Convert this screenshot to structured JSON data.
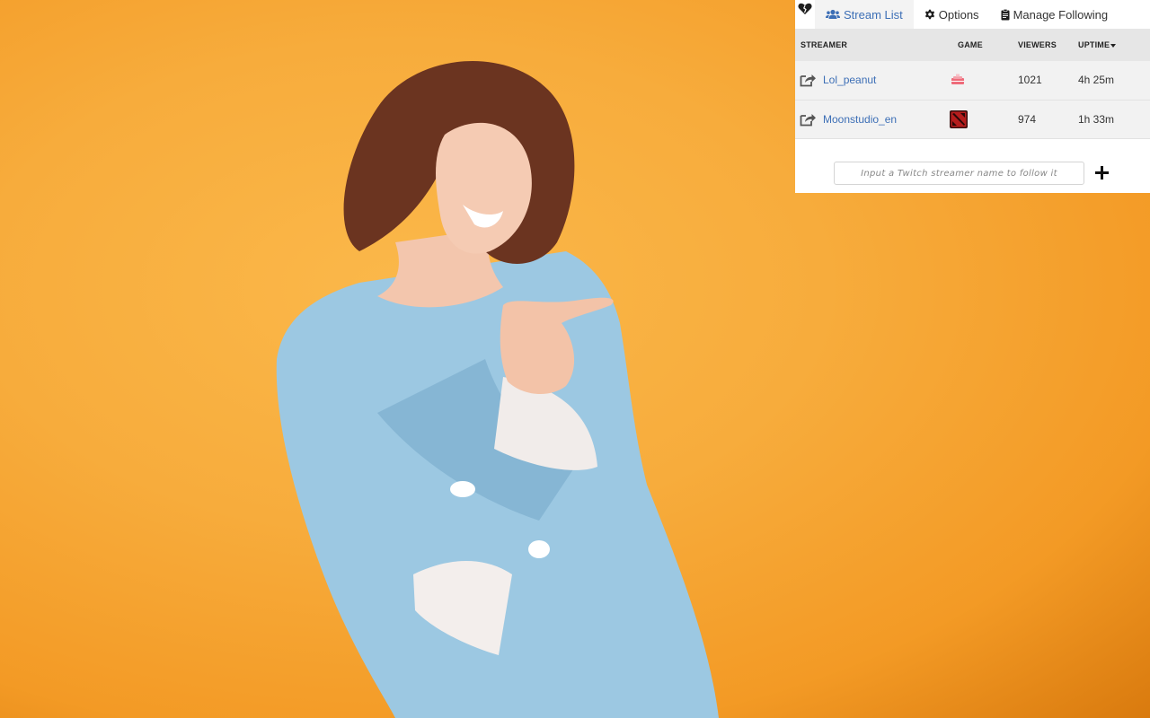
{
  "tabs": [
    {
      "label": "Stream List",
      "icon": "users-icon",
      "active": true
    },
    {
      "label": "Options",
      "icon": "gear-icon",
      "active": false
    },
    {
      "label": "Manage Following",
      "icon": "clipboard-icon",
      "active": false
    }
  ],
  "table": {
    "headers": {
      "streamer": "STREAMER",
      "game": "GAME",
      "viewers": "VIEWERS",
      "uptime": "UPTIME"
    },
    "rows": [
      {
        "streamer": "Lol_peanut",
        "game_icon": "game-pink-icon",
        "viewers": "1021",
        "uptime": "4h 25m"
      },
      {
        "streamer": "Moonstudio_en",
        "game_icon": "dota-icon",
        "viewers": "974",
        "uptime": "1h 33m"
      }
    ]
  },
  "follow": {
    "placeholder": "Input a Twitch streamer name to follow it"
  },
  "colors": {
    "accent": "#3d6fb6",
    "background": "#f7ac3c"
  }
}
